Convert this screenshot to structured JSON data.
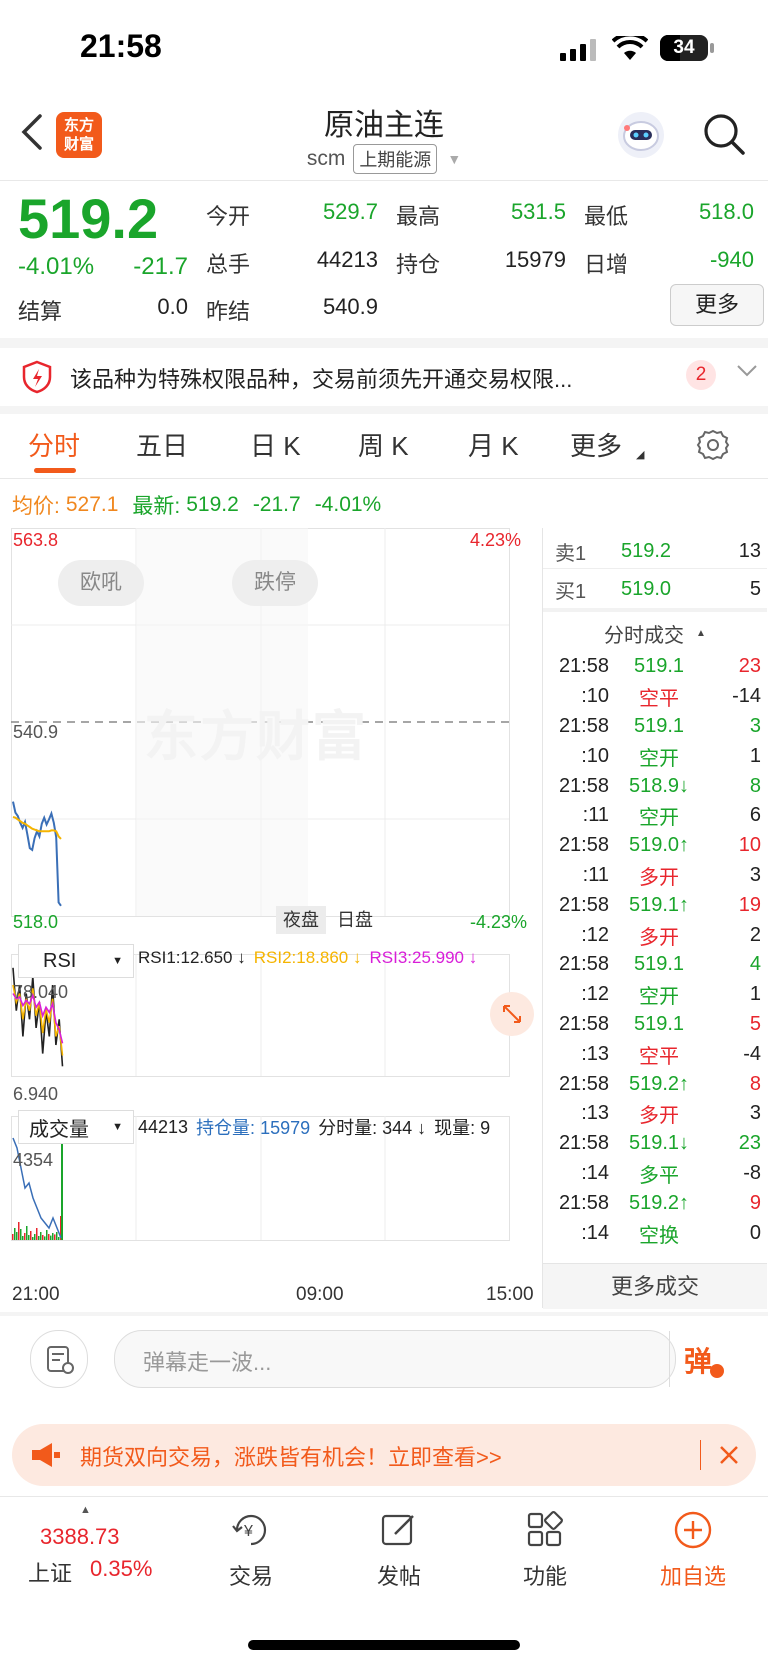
{
  "status": {
    "time": "21:58",
    "battery": "34"
  },
  "header": {
    "logo": [
      "东方",
      "财富"
    ],
    "title": "原油主连",
    "code": "scm",
    "exchange": "上期能源"
  },
  "quote": {
    "price": "519.2",
    "change_pct": "-4.01%",
    "change": "-21.7",
    "settle_label": "结算",
    "settle": "0.0",
    "fields": [
      {
        "label": "今开",
        "value": "529.7",
        "color": "green"
      },
      {
        "label": "最高",
        "value": "531.5",
        "color": "green"
      },
      {
        "label": "最低",
        "value": "518.0",
        "color": "green"
      },
      {
        "label": "总手",
        "value": "44213",
        "color": "black"
      },
      {
        "label": "持仓",
        "value": "15979",
        "color": "black"
      },
      {
        "label": "日增",
        "value": "-940",
        "color": "green"
      },
      {
        "label": "昨结",
        "value": "540.9",
        "color": "black"
      }
    ],
    "more_label": "更多"
  },
  "notice": {
    "text": "该品种为特殊权限品种，交易前须先开通交易权限...",
    "badge": "2"
  },
  "tabs": [
    "分时",
    "五日",
    "日 K",
    "周 K",
    "月 K",
    "更多"
  ],
  "infoline": {
    "avg_label": "均价:",
    "avg": "527.1",
    "last_label": "最新:",
    "last": "519.2",
    "chg": "-21.7",
    "pct": "-4.01%"
  },
  "chart": {
    "y_top": "563.8",
    "y_mid": "540.9",
    "y_bot": "518.0",
    "pct_top": "4.23%",
    "pct_bot": "-4.23%",
    "btn_left": "欧吼",
    "btn_right": "跌停",
    "session_night": "夜盘",
    "session_day": "日盘",
    "watermark": "东方财富",
    "rsi": {
      "selector": "RSI",
      "rsi1": "RSI1:12.650 ↓",
      "rsi2": "RSI2:18.860 ↓",
      "rsi3": "RSI3:25.990 ↓",
      "top": "78.040",
      "bot": "6.940"
    },
    "vol": {
      "selector": "成交量",
      "total": "44213",
      "oi": "持仓量: 15979",
      "minute": "分时量: 344 ↓",
      "now": "现量: 9",
      "top": "4354"
    },
    "x_labels": [
      "21:00",
      "09:00",
      "15:00"
    ]
  },
  "chart_data": {
    "type": "line",
    "title": "",
    "xlabel": "",
    "ylabel": "",
    "ylim": [
      518.0,
      563.8
    ],
    "x": [
      0,
      1,
      2,
      3,
      4,
      5,
      6,
      7,
      8,
      9,
      10,
      11,
      12,
      13,
      14,
      15,
      16,
      17,
      18,
      19,
      20
    ],
    "series": [
      {
        "name": "",
        "values": [
          531.5,
          530.2,
          529.8,
          529.0,
          528.4,
          529.1,
          527.6,
          526.0,
          525.8,
          527.2,
          528.0,
          527.4,
          528.9,
          529.6,
          528.8,
          529.4,
          530.1,
          529.0,
          527.3,
          519.6,
          519.2
        ]
      },
      {
        "name": "均价",
        "values": [
          529.7,
          529.6,
          529.4,
          529.2,
          529.0,
          528.9,
          528.7,
          528.5,
          528.3,
          528.2,
          528.1,
          528.0,
          528.0,
          528.0,
          528.0,
          528.0,
          528.1,
          528.1,
          528.0,
          527.4,
          527.1
        ]
      }
    ]
  },
  "orderbook": [
    {
      "side": "卖1",
      "price": "519.2",
      "qty": "13"
    },
    {
      "side": "买1",
      "price": "519.0",
      "qty": "5"
    }
  ],
  "ticks_header": "分时成交",
  "ticks": [
    {
      "time": "21:58",
      "price": "519.1",
      "arrow": "",
      "pcolor": "green",
      "qty": "23",
      "qcolor": "red"
    },
    {
      "time": ":10",
      "price": "空平",
      "arrow": "",
      "pcolor": "red",
      "qty": "-14",
      "qcolor": "black"
    },
    {
      "time": "21:58",
      "price": "519.1",
      "arrow": "",
      "pcolor": "green",
      "qty": "3",
      "qcolor": "green"
    },
    {
      "time": ":10",
      "price": "空开",
      "arrow": "",
      "pcolor": "green",
      "qty": "1",
      "qcolor": "black"
    },
    {
      "time": "21:58",
      "price": "518.9",
      "arrow": "↓",
      "pcolor": "green",
      "qty": "8",
      "qcolor": "green"
    },
    {
      "time": ":11",
      "price": "空开",
      "arrow": "",
      "pcolor": "green",
      "qty": "6",
      "qcolor": "black"
    },
    {
      "time": "21:58",
      "price": "519.0",
      "arrow": "↑",
      "pcolor": "green",
      "qty": "10",
      "qcolor": "red"
    },
    {
      "time": ":11",
      "price": "多开",
      "arrow": "",
      "pcolor": "red",
      "qty": "3",
      "qcolor": "black"
    },
    {
      "time": "21:58",
      "price": "519.1",
      "arrow": "↑",
      "pcolor": "green",
      "qty": "19",
      "qcolor": "red"
    },
    {
      "time": ":12",
      "price": "多开",
      "arrow": "",
      "pcolor": "red",
      "qty": "2",
      "qcolor": "black"
    },
    {
      "time": "21:58",
      "price": "519.1",
      "arrow": "",
      "pcolor": "green",
      "qty": "4",
      "qcolor": "green"
    },
    {
      "time": ":12",
      "price": "空开",
      "arrow": "",
      "pcolor": "green",
      "qty": "1",
      "qcolor": "black"
    },
    {
      "time": "21:58",
      "price": "519.1",
      "arrow": "",
      "pcolor": "green",
      "qty": "5",
      "qcolor": "red"
    },
    {
      "time": ":13",
      "price": "空平",
      "arrow": "",
      "pcolor": "red",
      "qty": "-4",
      "qcolor": "black"
    },
    {
      "time": "21:58",
      "price": "519.2",
      "arrow": "↑",
      "pcolor": "green",
      "qty": "8",
      "qcolor": "red"
    },
    {
      "time": ":13",
      "price": "多开",
      "arrow": "",
      "pcolor": "red",
      "qty": "3",
      "qcolor": "black"
    },
    {
      "time": "21:58",
      "price": "519.1",
      "arrow": "↓",
      "pcolor": "green",
      "qty": "23",
      "qcolor": "green"
    },
    {
      "time": ":14",
      "price": "多平",
      "arrow": "",
      "pcolor": "green",
      "qty": "-8",
      "qcolor": "black"
    },
    {
      "time": "21:58",
      "price": "519.2",
      "arrow": "↑",
      "pcolor": "green",
      "qty": "9",
      "qcolor": "red"
    },
    {
      "time": ":14",
      "price": "空换",
      "arrow": "",
      "pcolor": "green",
      "qty": "0",
      "qcolor": "black"
    }
  ],
  "more_ticks": "更多成交",
  "danmu": {
    "placeholder": "弹幕走一波...",
    "send": "弹"
  },
  "promo": {
    "text": "期货双向交易，涨跌皆有机会！立即查看>>"
  },
  "bottom_nav": {
    "index_value": "3388.73",
    "index_name": "上证",
    "index_pct": "0.35%",
    "items": [
      "交易",
      "发帖",
      "功能",
      "加自选"
    ]
  }
}
